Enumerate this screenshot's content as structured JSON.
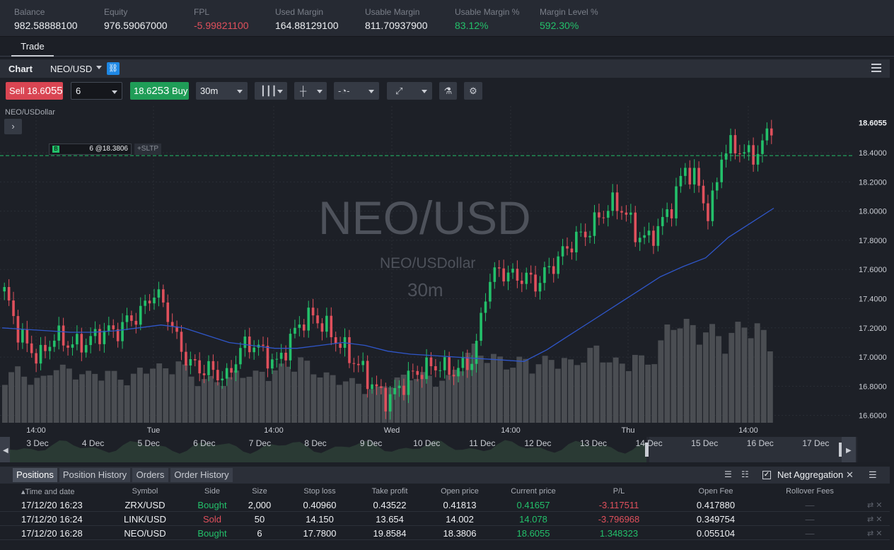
{
  "account": [
    {
      "label": "Balance",
      "value": "982.58888100",
      "tone": "normal"
    },
    {
      "label": "Equity",
      "value": "976.59067000",
      "tone": "normal"
    },
    {
      "label": "FPL",
      "value": "-5.99821100",
      "tone": "neg"
    },
    {
      "label": "Used Margin",
      "value": "164.88129100",
      "tone": "normal"
    },
    {
      "label": "Usable Margin",
      "value": "811.70937900",
      "tone": "normal"
    },
    {
      "label": "Usable Margin %",
      "value": "83.12%",
      "tone": "pos"
    },
    {
      "label": "Margin Level %",
      "value": "592.30%",
      "tone": "pos"
    }
  ],
  "tabs": {
    "trade": "Trade"
  },
  "chart": {
    "title": "Chart",
    "symbol": "NEO/USD",
    "series_name": "NEO/USDollar",
    "watermark": "NEO/USD",
    "watermark_sub": "NEO/USDollar",
    "watermark_tf": "30m",
    "sell_label": "Sell",
    "sell_price_small": "18.6",
    "sell_price_big": "055",
    "quantity": "6",
    "buy_price_small": "18.6",
    "buy_price_big": "253",
    "buy_label": "Buy",
    "timeframe": "30m",
    "order_tag": "6 @18.3806",
    "order_side": "B",
    "sltp_label": "+SLTP",
    "price_last": "18.6055"
  },
  "chart_data": {
    "type": "candlestick",
    "series": [
      {
        "name": "NEO/USDollar"
      }
    ],
    "interval": "30m",
    "y_ticks": [
      "16.6000",
      "16.8000",
      "17.0000",
      "17.2000",
      "17.4000",
      "17.6000",
      "17.8000",
      "18.0000",
      "18.2000",
      "18.4000"
    ],
    "ylim": [
      16.55,
      18.72
    ],
    "x_ticks": [
      "14:00",
      "Tue",
      "14:00",
      "Wed",
      "14:00",
      "Thu",
      "14:00"
    ],
    "last_price": 18.6055,
    "order_line": 18.3806,
    "close_path": [
      17.45,
      17.2,
      17.05,
      17.0,
      17.15,
      17.1,
      17.08,
      17.12,
      17.18,
      17.17,
      17.25,
      17.3,
      17.45,
      17.35,
      17.1,
      16.95,
      16.92,
      16.9,
      16.85,
      17.05,
      17.1,
      17.02,
      16.95,
      17.1,
      17.25,
      17.28,
      17.2,
      17.1,
      17.0,
      16.9,
      16.78,
      16.7,
      16.8,
      16.88,
      16.92,
      16.95,
      16.9,
      16.93,
      17.0,
      17.5,
      17.6,
      17.55,
      17.55,
      17.5,
      17.6,
      17.7,
      17.8,
      17.85,
      17.95,
      18.05,
      18.02,
      17.85,
      17.8,
      17.9,
      18.05,
      18.3,
      18.2,
      17.95,
      18.4,
      18.45,
      18.38,
      18.4,
      18.6
    ],
    "ma_line": [
      17.2,
      17.19,
      17.18,
      17.17,
      17.17,
      17.18,
      17.2,
      17.22,
      17.2,
      17.15,
      17.1,
      17.08,
      17.06,
      17.06,
      17.08,
      17.1,
      17.08,
      17.04,
      17.02,
      17.01,
      17.0,
      16.99,
      16.98,
      16.97,
      17.05,
      17.15,
      17.25,
      17.35,
      17.45,
      17.55,
      17.62,
      17.68,
      17.82,
      17.92,
      18.02
    ],
    "volume": [
      0.45,
      0.5,
      0.42,
      0.4,
      0.55,
      0.5,
      0.48,
      0.45,
      0.5,
      0.45,
      0.4,
      0.5,
      0.55,
      0.5,
      0.6,
      0.45,
      0.4,
      0.42,
      0.38,
      0.5,
      0.45,
      0.48,
      0.5,
      0.55,
      0.6,
      0.5,
      0.45,
      0.42,
      0.4,
      0.35,
      0.3,
      0.38,
      0.42,
      0.45,
      0.45,
      0.4,
      0.42,
      0.6,
      0.7,
      0.65,
      0.6,
      0.55,
      0.6,
      0.55,
      0.6,
      0.62,
      0.55,
      0.65,
      0.7,
      0.6,
      0.55,
      0.65,
      0.55,
      0.72,
      0.95,
      1.0,
      0.85,
      0.9,
      0.8,
      0.85,
      0.95,
      0.9,
      0.75
    ]
  },
  "navigator": {
    "dates": [
      "3 Dec",
      "4 Dec",
      "5 Dec",
      "6 Dec",
      "7 Dec",
      "8 Dec",
      "9 Dec",
      "10 Dec",
      "11 Dec",
      "12 Dec",
      "13 Dec",
      "14 Dec",
      "15 Dec",
      "16 Dec",
      "17 Dec"
    ]
  },
  "positions": {
    "tabs": [
      "Positions",
      "Position History",
      "Orders",
      "Order History"
    ],
    "net_aggregation": "Net Aggregation",
    "columns": [
      "Time and date",
      "Symbol",
      "Side",
      "Size",
      "Stop loss",
      "Take profit",
      "Open price",
      "Current price",
      "P/L",
      "Open Fee",
      "Rollover Fees"
    ],
    "rows": [
      {
        "time": "17/12/20 16:23",
        "symbol": "ZRX/USD",
        "side": "Bought",
        "size": "2,000",
        "sl": "0.40960",
        "tp": "0.43522",
        "open": "0.41813",
        "current": "0.41657",
        "pl": "-3.117511",
        "fee": "0.417880",
        "rollover": "—"
      },
      {
        "time": "17/12/20 16:24",
        "symbol": "LINK/USD",
        "side": "Sold",
        "size": "50",
        "sl": "14.150",
        "tp": "13.654",
        "open": "14.002",
        "current": "14.078",
        "pl": "-3.796968",
        "fee": "0.349754",
        "rollover": "—"
      },
      {
        "time": "17/12/20 16:28",
        "symbol": "NEO/USD",
        "side": "Bought",
        "size": "6",
        "sl": "17.7800",
        "tp": "19.8584",
        "open": "18.3806",
        "current": "18.6055",
        "pl": "1.348323",
        "fee": "0.055104",
        "rollover": "—"
      }
    ]
  }
}
